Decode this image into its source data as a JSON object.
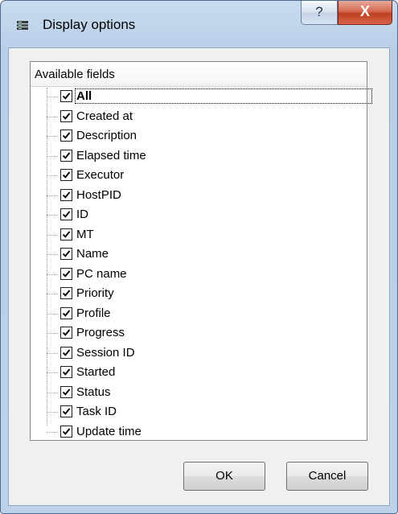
{
  "window": {
    "title": "Display options",
    "help_label": "?",
    "close_label": "X"
  },
  "list": {
    "header": "Available fields",
    "items": [
      {
        "label": "All",
        "checked": true,
        "selected": true
      },
      {
        "label": "Created at",
        "checked": true
      },
      {
        "label": "Description",
        "checked": true
      },
      {
        "label": "Elapsed time",
        "checked": true
      },
      {
        "label": "Executor",
        "checked": true
      },
      {
        "label": "HostPID",
        "checked": true
      },
      {
        "label": "ID",
        "checked": true
      },
      {
        "label": "MT",
        "checked": true
      },
      {
        "label": "Name",
        "checked": true
      },
      {
        "label": "PC name",
        "checked": true
      },
      {
        "label": "Priority",
        "checked": true
      },
      {
        "label": "Profile",
        "checked": true
      },
      {
        "label": "Progress",
        "checked": true
      },
      {
        "label": "Session ID",
        "checked": true
      },
      {
        "label": "Started",
        "checked": true
      },
      {
        "label": "Status",
        "checked": true
      },
      {
        "label": "Task ID",
        "checked": true
      },
      {
        "label": "Update time",
        "checked": true
      }
    ]
  },
  "buttons": {
    "ok": "OK",
    "cancel": "Cancel"
  }
}
